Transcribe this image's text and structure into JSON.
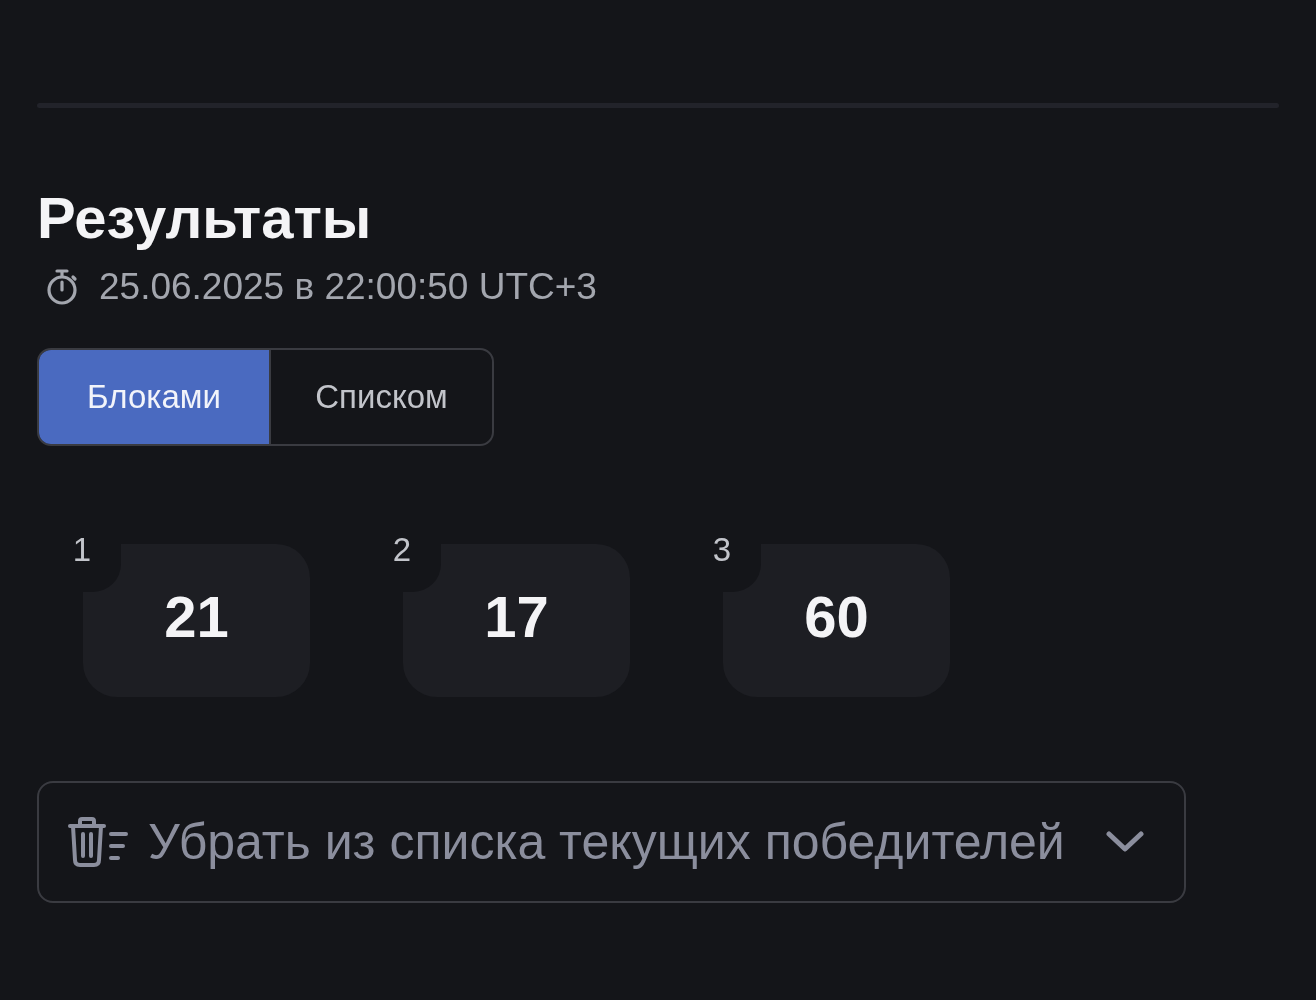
{
  "section": {
    "title": "Результаты",
    "timestamp": "25.06.2025 в 22:00:50 UTC+3"
  },
  "view_toggle": [
    {
      "label": "Блоками",
      "selected": true
    },
    {
      "label": "Списком",
      "selected": false
    }
  ],
  "results": [
    {
      "rank": "1",
      "number": "21"
    },
    {
      "rank": "2",
      "number": "17"
    },
    {
      "rank": "3",
      "number": "60"
    }
  ],
  "remove_dropdown": {
    "label": "Убрать из списка текущих победителей"
  }
}
